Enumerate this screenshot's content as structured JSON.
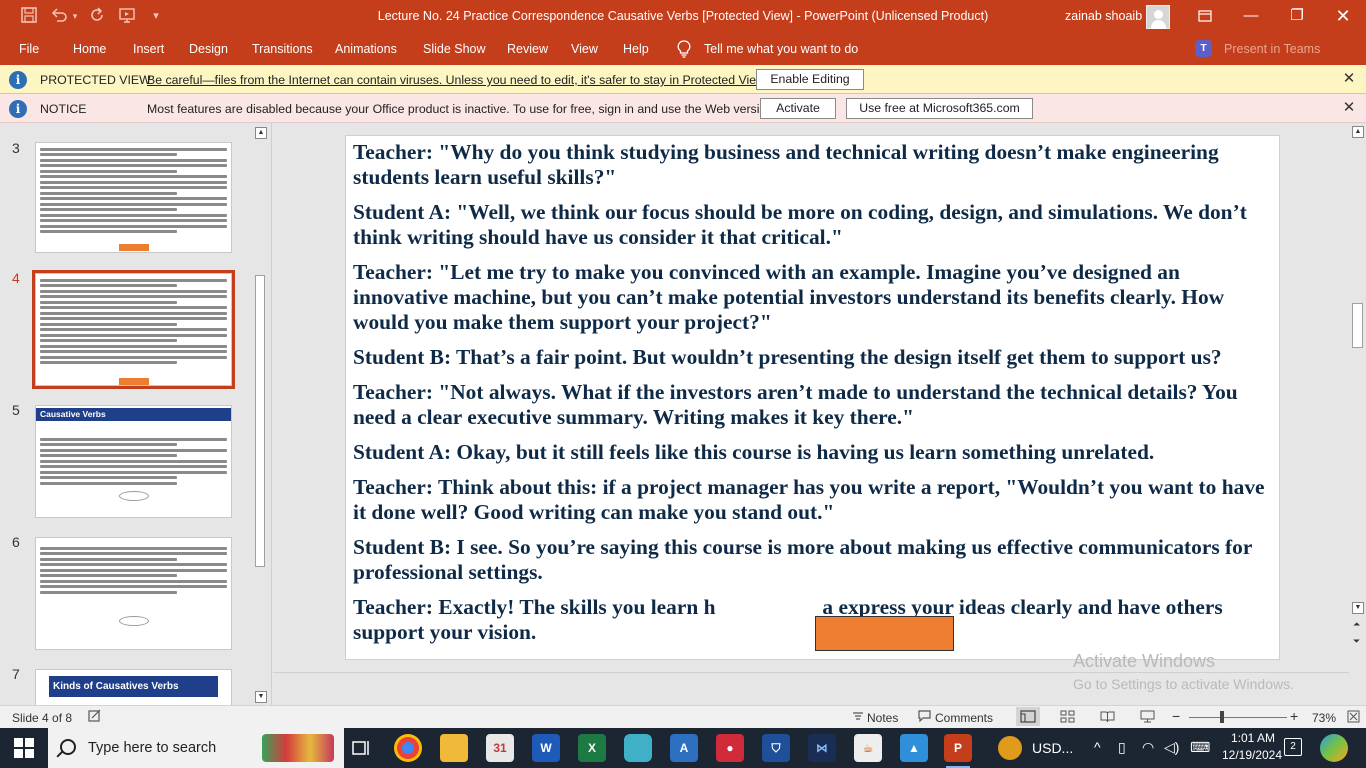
{
  "titlebar": {
    "title": "Lecture No. 24  Practice Correspondence Causative Verbs [Protected View]  -  PowerPoint (Unlicensed Product)",
    "user": "zainab shoaib"
  },
  "ribbon": {
    "tabs": [
      "File",
      "Home",
      "Insert",
      "Design",
      "Transitions",
      "Animations",
      "Slide Show",
      "Review",
      "View",
      "Help"
    ],
    "tell_me": "Tell me what you want to do",
    "present_in_teams": "Present in Teams",
    "teams_badge": "T"
  },
  "protected_bar": {
    "title": "PROTECTED VIEW",
    "message": "Be careful—files from the Internet can contain viruses. Unless you need to edit, it's safer to stay in Protected View.",
    "button": "Enable Editing"
  },
  "notice_bar": {
    "title": "NOTICE",
    "message": "Most features are disabled because your Office product is inactive. To use for free, sign in and use the Web version.",
    "activate_button": "Activate",
    "web_button": "Use free at Microsoft365.com"
  },
  "thumbnails": {
    "numbers": [
      "3",
      "4",
      "5",
      "6",
      "7"
    ],
    "slide5_title": "Causative Verbs",
    "slide7_title": "Kinds of Causatives Verbs"
  },
  "slide": {
    "paragraphs": [
      " Teacher:  \"Why do you think studying business and technical writing doesn’t make engineering students learn useful skills?\"",
      "Student A:  \"Well, we think our focus should be more on coding, design, and simulations. We don’t think writing should have us consider it that critical.\"",
      "Teacher:  \"Let me try to make you convinced with an example. Imagine you’ve designed an innovative machine, but you can’t make potential investors understand its benefits clearly. How would you make them support your project?\"",
      "Student B: That’s a fair point. But wouldn’t presenting the design itself get them to support us?",
      "Teacher:  \"Not always. What if the investors aren’t made to understand the technical details? You need a clear executive summary. Writing makes it key there.\"",
      "Student A: Okay, but it still feels like this course is having us learn something unrelated.",
      "Teacher: Think about this: if a project manager has you write a report, \"Wouldn’t you want to have it done well? Good writing can make you stand out.\"",
      "Student B: I see. So you’re saying this course is more about making us effective communicators for professional settings.",
      "Teacher: Exactly! The skills you learn h                    a express your ideas clearly and have others support your vision."
    ]
  },
  "watermark": {
    "line1": "Activate Windows",
    "line2": "Go to Settings to activate Windows."
  },
  "statusbar": {
    "slide_info": "Slide 4 of 8",
    "notes": "Notes",
    "comments": "Comments",
    "zoom": "73%"
  },
  "taskbar": {
    "search_placeholder": "Type here to search",
    "currency": "USD...",
    "time": "1:01 AM",
    "date": "12/19/2024",
    "notifications": "2"
  },
  "colors": {
    "accent": "#c43e1c",
    "slide_text": "#0e2a47",
    "redaction": "#ed7d31",
    "thumbnail_header": "#1f3f8a"
  }
}
